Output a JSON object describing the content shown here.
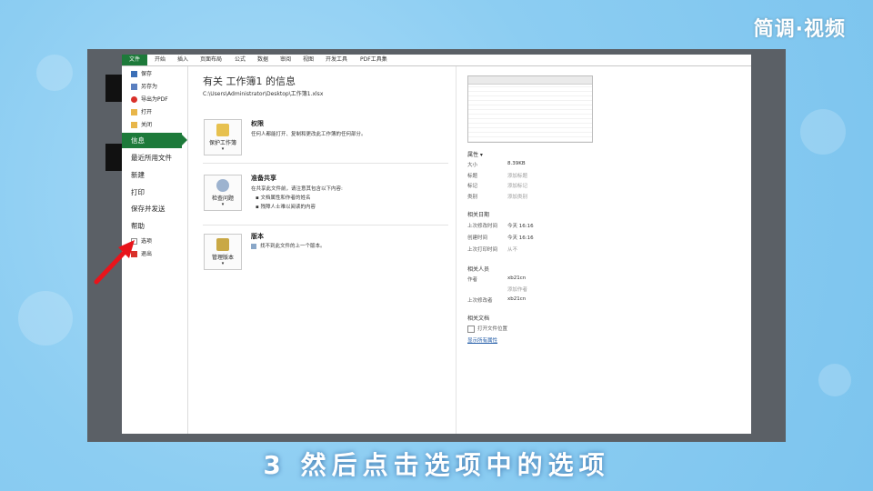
{
  "watermark": "简调·视频",
  "caption": "3 然后点击选项中的选项",
  "colors": {
    "accent": "#1d7a3a",
    "arrow": "#e8141b",
    "frame": "#5b6066"
  },
  "ribbon": {
    "file": "文件",
    "tabs": [
      "开始",
      "插入",
      "页面布局",
      "公式",
      "数据",
      "审阅",
      "视图",
      "开发工具",
      "PDF工具集"
    ]
  },
  "sidebar": {
    "small_top": [
      {
        "label": "保存",
        "icon": "save-icon"
      },
      {
        "label": "另存为",
        "icon": "save-as-icon"
      },
      {
        "label": "导出为PDF",
        "icon": "pdf-icon"
      },
      {
        "label": "打开",
        "icon": "folder-open-icon"
      },
      {
        "label": "关闭",
        "icon": "folder-close-icon"
      }
    ],
    "active": "信息",
    "big": [
      "最近所用文件",
      "新建",
      "打印",
      "保存并发送",
      "帮助"
    ],
    "small_bottom": [
      {
        "label": "选项",
        "icon": "options-icon"
      },
      {
        "label": "退出",
        "icon": "exit-icon"
      }
    ]
  },
  "main": {
    "title": "有关 工作簿1 的信息",
    "path": "C:\\Users\\Administrator\\Desktop\\工作簿1.xlsx",
    "sections": [
      {
        "button": "保护工作簿",
        "heading": "权限",
        "desc": [
          "任何人都能打开、复制和更改此工作簿的任何部分。"
        ]
      },
      {
        "button": "检查问题",
        "heading": "准备共享",
        "desc": [
          "在共享此文件前，请注意其包含以下内容:",
          "文档属性和作者的姓名",
          "残障人士难以阅读的内容"
        ]
      },
      {
        "button": "管理版本",
        "heading": "版本",
        "desc": [
          "找不到此文件的上一个版本。"
        ]
      }
    ]
  },
  "right": {
    "props_header": "属性 ▾",
    "props": [
      {
        "k": "大小",
        "v": "8.39KB",
        "gray": false
      },
      {
        "k": "标题",
        "v": "添加标题",
        "gray": true
      },
      {
        "k": "标记",
        "v": "添加标记",
        "gray": true
      },
      {
        "k": "类别",
        "v": "添加类别",
        "gray": true
      }
    ],
    "dates_header": "相关日期",
    "dates": [
      {
        "k": "上次修改时间",
        "v": "今天 16:16",
        "gray": false
      },
      {
        "k": "创建时间",
        "v": "今天 16:16",
        "gray": false
      },
      {
        "k": "上次打印时间",
        "v": "从不",
        "gray": true
      }
    ],
    "people_header": "相关人员",
    "author_k": "作者",
    "author_v": "xb21cn",
    "add_author": "添加作者",
    "modified_by_k": "上次修改者",
    "modified_by_v": "xb21cn",
    "docs_header": "相关文档",
    "open_location": "打开文件位置",
    "show_all": "显示所有属性"
  }
}
